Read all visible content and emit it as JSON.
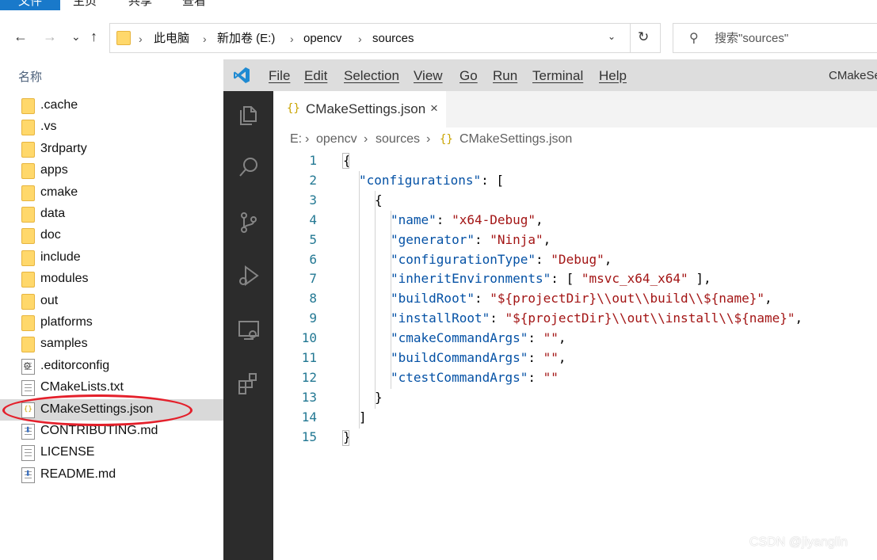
{
  "explorer": {
    "ribbon_tabs": [
      "文件",
      "主页",
      "共享",
      "查看"
    ],
    "nav": {
      "back": "←",
      "forward": "→",
      "recent": "⌄",
      "up": "↑"
    },
    "breadcrumb": [
      "此电脑",
      "新加卷 (E:)",
      "opencv",
      "sources"
    ],
    "search_placeholder": "搜索\"sources\"",
    "column_header": "名称",
    "files": [
      {
        "name": ".cache",
        "type": "folder"
      },
      {
        "name": ".vs",
        "type": "folder"
      },
      {
        "name": "3rdparty",
        "type": "folder"
      },
      {
        "name": "apps",
        "type": "folder"
      },
      {
        "name": "cmake",
        "type": "folder"
      },
      {
        "name": "data",
        "type": "folder"
      },
      {
        "name": "doc",
        "type": "folder"
      },
      {
        "name": "include",
        "type": "folder"
      },
      {
        "name": "modules",
        "type": "folder"
      },
      {
        "name": "out",
        "type": "folder"
      },
      {
        "name": "platforms",
        "type": "folder"
      },
      {
        "name": "samples",
        "type": "folder"
      },
      {
        "name": ".editorconfig",
        "type": "config"
      },
      {
        "name": "CMakeLists.txt",
        "type": "text"
      },
      {
        "name": "CMakeSettings.json",
        "type": "json",
        "selected": true
      },
      {
        "name": "CONTRIBUTING.md",
        "type": "markdown"
      },
      {
        "name": "LICENSE",
        "type": "text"
      },
      {
        "name": "README.md",
        "type": "markdown"
      }
    ]
  },
  "vscode": {
    "menu": [
      "File",
      "Edit",
      "Selection",
      "View",
      "Go",
      "Run",
      "Terminal",
      "Help"
    ],
    "title": "CMakeSettings.json",
    "tab": {
      "label": "CMakeSettings.json",
      "icon": "{}",
      "close": "×"
    },
    "breadcrumb": [
      "E:",
      "opencv",
      "sources",
      "CMakeSettings.json"
    ],
    "activity_icons": [
      "explorer-icon",
      "search-icon",
      "source-control-icon",
      "run-debug-icon",
      "remote-explorer-icon",
      "extensions-icon"
    ],
    "code_lines": [
      {
        "n": "1",
        "indent": 0,
        "tokens": [
          [
            "p",
            "{"
          ]
        ]
      },
      {
        "n": "2",
        "indent": 1,
        "tokens": [
          [
            "k",
            "\"configurations\""
          ],
          [
            "p",
            ": ["
          ]
        ]
      },
      {
        "n": "3",
        "indent": 2,
        "tokens": [
          [
            "p",
            "{"
          ]
        ]
      },
      {
        "n": "4",
        "indent": 3,
        "tokens": [
          [
            "k",
            "\"name\""
          ],
          [
            "p",
            ": "
          ],
          [
            "s",
            "\"x64-Debug\""
          ],
          [
            "p",
            ","
          ]
        ]
      },
      {
        "n": "5",
        "indent": 3,
        "tokens": [
          [
            "k",
            "\"generator\""
          ],
          [
            "p",
            ": "
          ],
          [
            "s",
            "\"Ninja\""
          ],
          [
            "p",
            ","
          ]
        ]
      },
      {
        "n": "6",
        "indent": 3,
        "tokens": [
          [
            "k",
            "\"configurationType\""
          ],
          [
            "p",
            ": "
          ],
          [
            "s",
            "\"Debug\""
          ],
          [
            "p",
            ","
          ]
        ]
      },
      {
        "n": "7",
        "indent": 3,
        "tokens": [
          [
            "k",
            "\"inheritEnvironments\""
          ],
          [
            "p",
            ": [ "
          ],
          [
            "s",
            "\"msvc_x64_x64\""
          ],
          [
            "p",
            " ],"
          ]
        ]
      },
      {
        "n": "8",
        "indent": 3,
        "tokens": [
          [
            "k",
            "\"buildRoot\""
          ],
          [
            "p",
            ": "
          ],
          [
            "s",
            "\"${projectDir}\\\\out\\\\build\\\\${name}\""
          ],
          [
            "p",
            ","
          ]
        ]
      },
      {
        "n": "9",
        "indent": 3,
        "tokens": [
          [
            "k",
            "\"installRoot\""
          ],
          [
            "p",
            ": "
          ],
          [
            "s",
            "\"${projectDir}\\\\out\\\\install\\\\${name}\""
          ],
          [
            "p",
            ","
          ]
        ]
      },
      {
        "n": "10",
        "indent": 3,
        "tokens": [
          [
            "k",
            "\"cmakeCommandArgs\""
          ],
          [
            "p",
            ": "
          ],
          [
            "s",
            "\"\""
          ],
          [
            "p",
            ","
          ]
        ]
      },
      {
        "n": "11",
        "indent": 3,
        "tokens": [
          [
            "k",
            "\"buildCommandArgs\""
          ],
          [
            "p",
            ": "
          ],
          [
            "s",
            "\"\""
          ],
          [
            "p",
            ","
          ]
        ]
      },
      {
        "n": "12",
        "indent": 3,
        "tokens": [
          [
            "k",
            "\"ctestCommandArgs\""
          ],
          [
            "p",
            ": "
          ],
          [
            "s",
            "\"\""
          ]
        ]
      },
      {
        "n": "13",
        "indent": 2,
        "tokens": [
          [
            "p",
            "}"
          ]
        ]
      },
      {
        "n": "14",
        "indent": 1,
        "tokens": [
          [
            "p",
            "]"
          ]
        ]
      },
      {
        "n": "15",
        "indent": 0,
        "tokens": [
          [
            "p",
            "}"
          ]
        ]
      }
    ]
  },
  "watermark": "CSDN @jiyanglin",
  "colors": {
    "explorer_accent": "#1979ca",
    "vscode_activitybar": "#2c2c2c",
    "json_key": "#0451a5",
    "json_string": "#a31515",
    "line_number": "#237893",
    "highlight_ellipse": "#e4202b"
  }
}
